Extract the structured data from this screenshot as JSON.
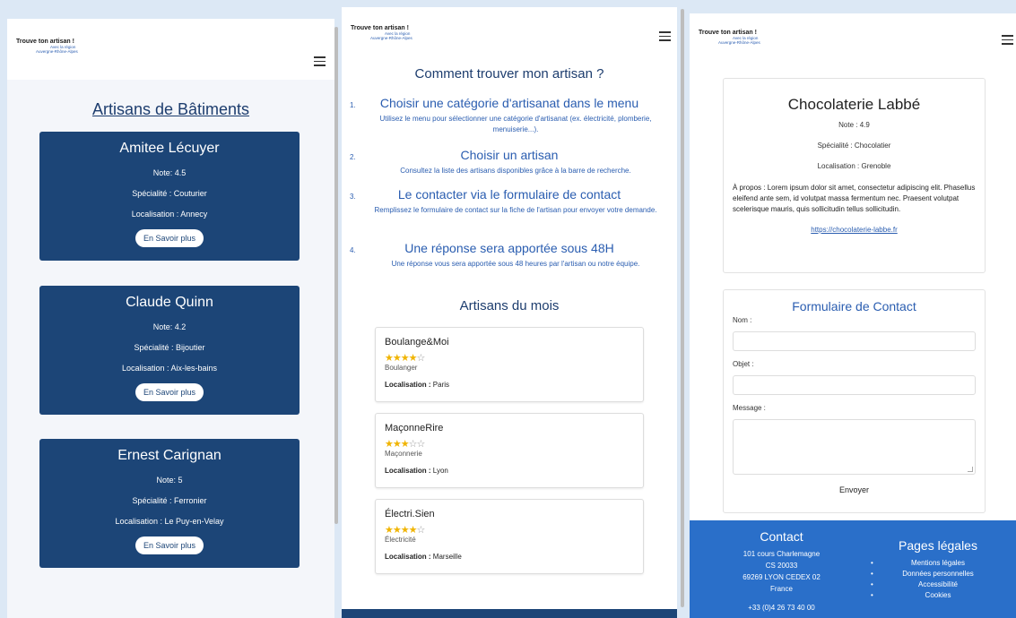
{
  "logo": {
    "line1": "Trouve ton artisan !",
    "line2": "Avec la région",
    "line3": "Auvergne-Rhône-Alpes"
  },
  "panel1": {
    "title": "Artisans de Bâtiments",
    "cards": [
      {
        "name": "Amitee Lécuyer",
        "note": "Note: 4.5",
        "speciality": "Spécialité : Couturier",
        "location": "Localisation : Annecy",
        "button": "En Savoir plus"
      },
      {
        "name": "Claude Quinn",
        "note": "Note: 4.2",
        "speciality": "Spécialité : Bijoutier",
        "location": "Localisation : Aix-les-bains",
        "button": "En Savoir plus"
      },
      {
        "name": "Ernest Carignan",
        "note": "Note: 5",
        "speciality": "Spécialité : Ferronier",
        "location": "Localisation : Le Puy-en-Velay",
        "button": "En Savoir plus"
      }
    ]
  },
  "panel2": {
    "heading": "Comment trouver mon artisan ?",
    "steps": [
      {
        "num": "1.",
        "title": "Choisir une catégorie d'artisanat dans le menu",
        "desc": "Utilisez le menu pour sélectionner une catégorie d'artisanat (ex. électricité, plomberie, menuiserie...)."
      },
      {
        "num": "2.",
        "title": "Choisir un artisan",
        "desc": "Consultez la liste des artisans disponibles grâce à la barre de recherche."
      },
      {
        "num": "3.",
        "title": "Le contacter via le formulaire de contact",
        "desc": "Remplissez le formulaire de contact sur la fiche de l'artisan pour envoyer votre demande."
      },
      {
        "num": "4.",
        "title": "Une réponse sera apportée sous 48H",
        "desc": "Une réponse vous sera apportée sous 48 heures par l'artisan ou notre équipe."
      }
    ],
    "month_heading": "Artisans du mois",
    "month": [
      {
        "name": "Boulange&Moi",
        "rating": 4,
        "speciality": "Boulanger",
        "loc_label": "Localisation :",
        "loc": "Paris"
      },
      {
        "name": "MaçonneRire",
        "rating": 3,
        "speciality": "Maçonnerie",
        "loc_label": "Localisation :",
        "loc": "Lyon"
      },
      {
        "name": "Électri.Sien",
        "rating": 4,
        "speciality": "Électricité",
        "loc_label": "Localisation :",
        "loc": "Marseille"
      }
    ]
  },
  "panel3": {
    "name": "Chocolaterie Labbé",
    "note": "Note : 4.9",
    "speciality": "Spécialité : Chocolatier",
    "location": "Localisation : Grenoble",
    "about": "À propos : Lorem ipsum dolor sit amet, consectetur adipiscing elit. Phasellus eleifend ante sem, id volutpat massa fermentum nec. Praesent volutpat scelerisque mauris, quis sollicitudin tellus sollicitudin.",
    "link": "https://chocolaterie-labbe.fr",
    "form": {
      "title": "Formulaire de Contact",
      "name_label": "Nom :",
      "subject_label": "Objet :",
      "message_label": "Message :",
      "send": "Envoyer"
    },
    "footer": {
      "contact_title": "Contact",
      "address": [
        "101 cours Charlemagne",
        "CS 20033",
        "69269 LYON CEDEX 02",
        "France"
      ],
      "phone": "+33 (0)4 26 73 40 00",
      "legal_title": "Pages légales",
      "legal": [
        "Mentions légales",
        "Données personnelles",
        "Accessibilité",
        "Cookies"
      ]
    }
  }
}
